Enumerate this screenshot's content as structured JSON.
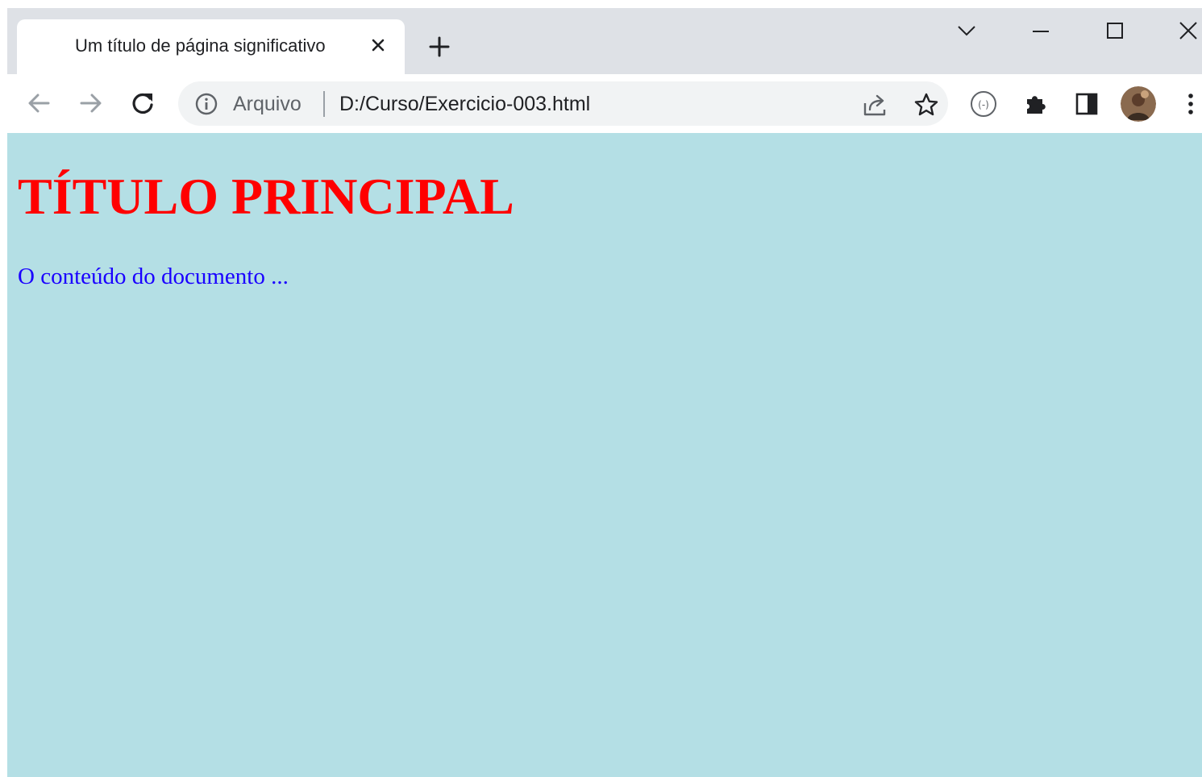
{
  "browser": {
    "tab": {
      "title": "Um título de página significativo"
    },
    "icons": {
      "tab_close": "close-icon",
      "new_tab": "plus-icon",
      "tab_search": "chevron-down-icon",
      "minimize": "minimize-icon",
      "maximize": "maximize-icon",
      "close_window": "close-icon",
      "back": "back-arrow-icon",
      "forward": "forward-arrow-icon",
      "reload": "reload-icon",
      "site_info": "info-icon",
      "share": "share-icon",
      "bookmark": "star-icon",
      "extension_a": "extension-circle-icon",
      "extensions": "puzzle-icon",
      "side_panel": "side-panel-icon",
      "profile": "avatar",
      "menu": "kebab-menu-icon"
    },
    "address_bar": {
      "scheme_label": "Arquivo",
      "url": "D:/Curso/Exercicio-003.html"
    }
  },
  "page": {
    "heading": "TÍTULO PRINCIPAL",
    "paragraph": "O conteúdo do documento ...",
    "colors": {
      "background": "#b4dfe5",
      "heading": "#ff0000",
      "paragraph": "#1a00ff"
    }
  }
}
